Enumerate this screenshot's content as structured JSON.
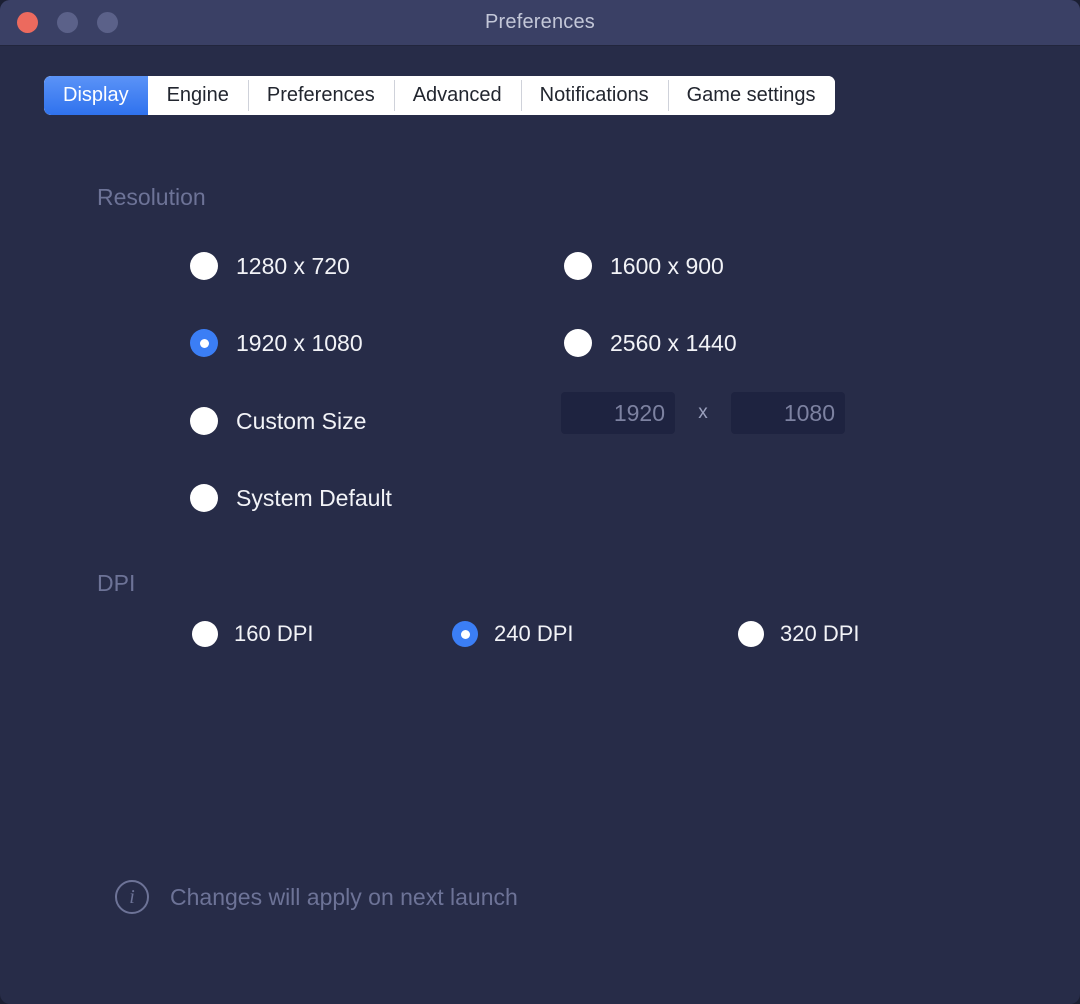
{
  "window": {
    "title": "Preferences",
    "controls": {
      "close": "close-button",
      "minimize": "minimize-button",
      "maximize": "maximize-button"
    },
    "colors": {
      "titlebar": "#3a4065",
      "body": "#272c48",
      "accent": "#3b7ef5",
      "close_button": "#ec6a5e",
      "muted_text": "#6d7397",
      "input_background": "#1e2340"
    }
  },
  "tabs": [
    {
      "label": "Display",
      "active": true
    },
    {
      "label": "Engine",
      "active": false
    },
    {
      "label": "Preferences",
      "active": false
    },
    {
      "label": "Advanced",
      "active": false
    },
    {
      "label": "Notifications",
      "active": false
    },
    {
      "label": "Game settings",
      "active": false
    }
  ],
  "resolution": {
    "title": "Resolution",
    "options": [
      {
        "label": "1280 x 720",
        "selected": false
      },
      {
        "label": "1920 x 1080",
        "selected": true
      },
      {
        "label": "Custom Size",
        "selected": false
      },
      {
        "label": "System Default",
        "selected": false
      },
      {
        "label": "1600 x 900",
        "selected": false
      },
      {
        "label": "2560 x 1440",
        "selected": false
      }
    ],
    "custom_size": {
      "width_value": "",
      "width_placeholder": "1920",
      "separator": "x",
      "height_value": "",
      "height_placeholder": "1080"
    }
  },
  "dpi": {
    "title": "DPI",
    "options": [
      {
        "label": "160 DPI",
        "selected": false
      },
      {
        "label": "240 DPI",
        "selected": true
      },
      {
        "label": "320 DPI",
        "selected": false
      }
    ]
  },
  "footer": {
    "icon": "info-icon",
    "icon_glyph": "i",
    "text": "Changes will apply on next launch"
  }
}
